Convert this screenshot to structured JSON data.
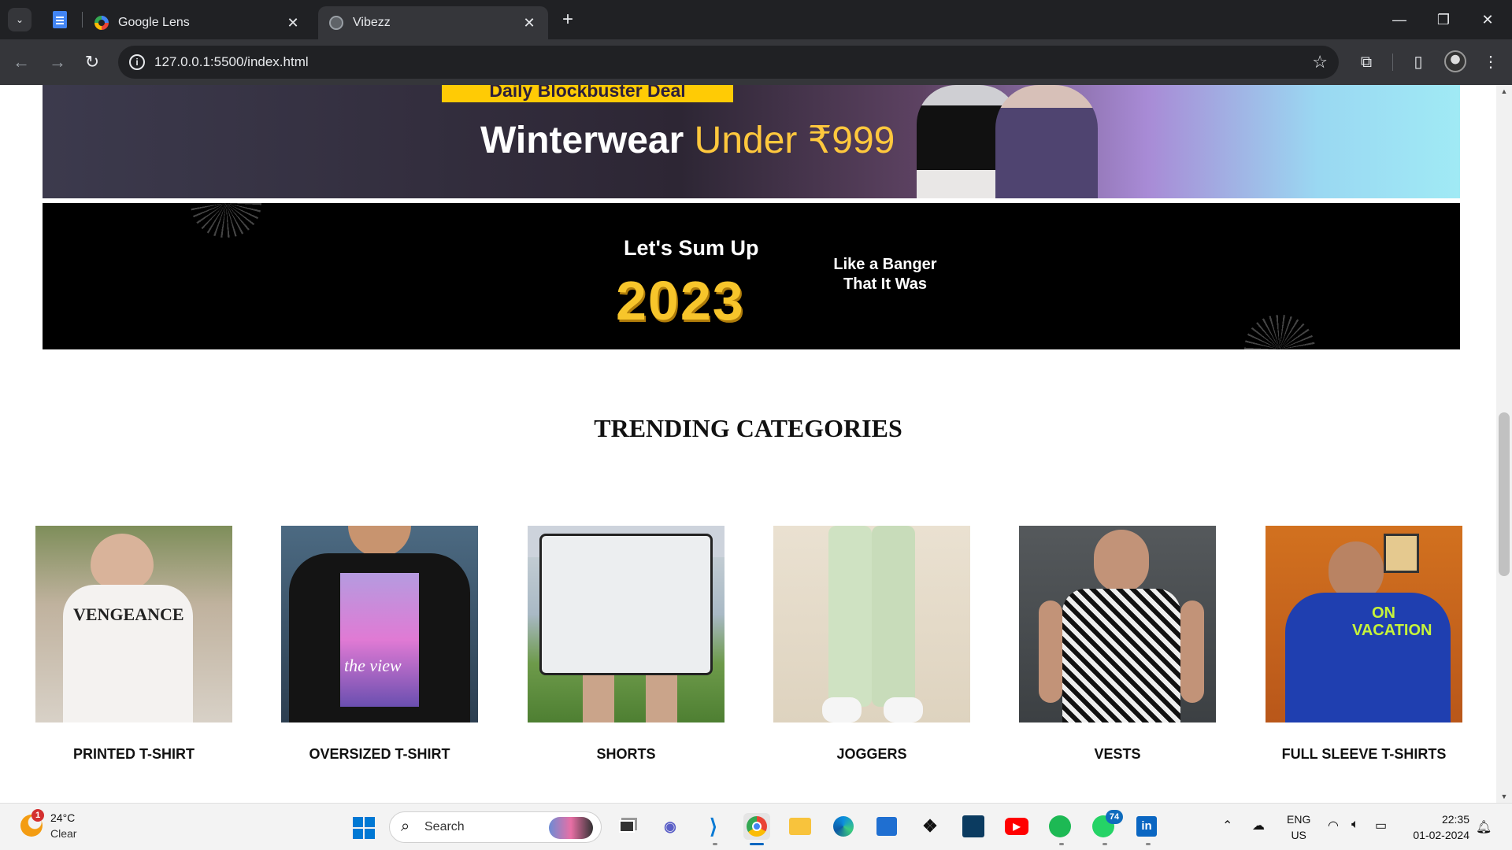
{
  "browser": {
    "tabs": [
      {
        "title": "Google Lens",
        "favicon": "google-lens-icon",
        "active": false
      },
      {
        "title": "Vibezz",
        "favicon": "globe-icon",
        "active": true
      }
    ],
    "address": "127.0.0.1:5500/index.html",
    "controls": {
      "tab_search": "⌄",
      "new_tab": "+",
      "minimize": "—",
      "restore": "❐",
      "close": "✕",
      "tab_close": "✕"
    },
    "nav": {
      "back": "←",
      "forward": "→",
      "reload": "↻",
      "info": "i",
      "star": "☆",
      "extensions": "⧉",
      "sidebar": "▯",
      "menu": "⋮"
    }
  },
  "page": {
    "banner_top": {
      "deal_label": "Daily Blockbuster Deal",
      "headline_main": "Winterwear",
      "headline_highlight": "Under ₹999"
    },
    "banner_second": {
      "line1": "Let's Sum Up",
      "year": "2023",
      "tagline_line1": "Like a Banger",
      "tagline_line2": "That It Was"
    },
    "section_title": "TRENDING CATEGORIES",
    "categories": [
      {
        "label": "PRINTED T-SHIRT",
        "graphic_text": "VENGEANCE"
      },
      {
        "label": "OVERSIZED T-SHIRT",
        "graphic_text": "the view"
      },
      {
        "label": "SHORTS"
      },
      {
        "label": "JOGGERS"
      },
      {
        "label": "VESTS"
      },
      {
        "label": "FULL SLEEVE T-SHIRTS",
        "graphic_text": "ON VACATION"
      }
    ]
  },
  "taskbar": {
    "weather": {
      "temp": "24°C",
      "condition": "Clear",
      "badge": "1"
    },
    "search_placeholder": "Search",
    "apps": [
      "file-explorer-icon",
      "chat-icon",
      "vscode-icon",
      "chrome-icon",
      "folder-icon",
      "edge-icon",
      "store-icon",
      "dropbox-icon",
      "terminal-icon",
      "youtube-icon",
      "spotify-icon",
      "whatsapp-icon",
      "linkedin-icon"
    ],
    "whatsapp_badge": "74",
    "lang_line1": "ENG",
    "lang_line2": "US",
    "time": "22:35",
    "date": "01-02-2024"
  }
}
